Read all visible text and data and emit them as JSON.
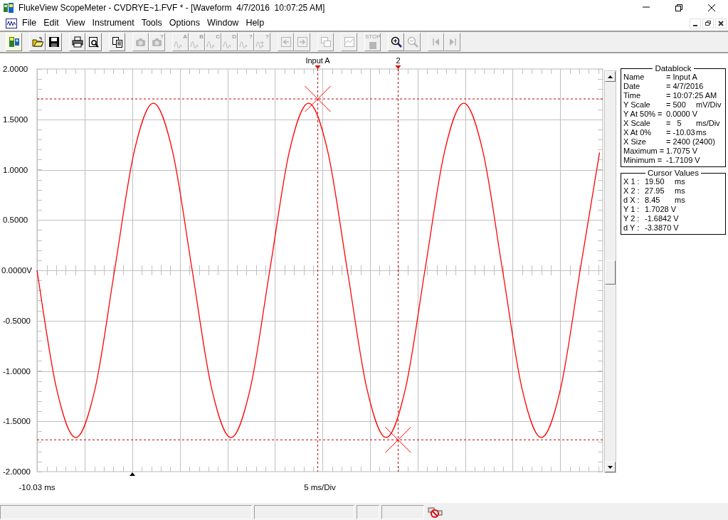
{
  "window": {
    "title": "FlukeView ScopeMeter - CVDRYE~1.FVF * - [Waveform  4/7/2016  10:07:25 AM]"
  },
  "menu": [
    "File",
    "Edit",
    "View",
    "Instrument",
    "Tools",
    "Options",
    "Window",
    "Help"
  ],
  "toolbar": [
    [
      {
        "kind": "connect",
        "disabled": false
      }
    ],
    [
      {
        "kind": "open",
        "disabled": false
      },
      {
        "kind": "save",
        "disabled": false
      }
    ],
    [
      {
        "kind": "print",
        "disabled": false
      },
      {
        "kind": "preview",
        "disabled": false
      }
    ],
    [
      {
        "kind": "copy",
        "disabled": false
      }
    ],
    [
      {
        "kind": "camera",
        "disabled": true
      },
      {
        "kind": "camera",
        "disabled": true,
        "caption": "?"
      }
    ],
    [
      {
        "kind": "wave",
        "disabled": true,
        "caption": "A"
      },
      {
        "kind": "wave",
        "disabled": true,
        "caption": "B"
      },
      {
        "kind": "wave",
        "disabled": true,
        "caption": "C"
      },
      {
        "kind": "wave",
        "disabled": true,
        "caption": "D"
      },
      {
        "kind": "wave",
        "disabled": true,
        "caption": "?"
      },
      {
        "kind": "wave-send",
        "disabled": true,
        "caption": "?"
      }
    ],
    [
      {
        "kind": "import",
        "disabled": true
      },
      {
        "kind": "export",
        "disabled": true
      }
    ],
    [
      {
        "kind": "windows",
        "disabled": true
      }
    ],
    [
      {
        "kind": "trend",
        "disabled": true
      }
    ],
    [
      {
        "kind": "stop",
        "disabled": true,
        "caption": "STOP"
      }
    ],
    [
      {
        "kind": "zoom-in",
        "disabled": false
      },
      {
        "kind": "zoom-out",
        "disabled": true
      }
    ],
    [
      {
        "kind": "first",
        "disabled": true
      },
      {
        "kind": "last",
        "disabled": true
      }
    ]
  ],
  "plot": {
    "chart_data": {
      "type": "line",
      "ylim": [
        -2,
        2
      ],
      "grid": true,
      "yticks": [
        {
          "value": 2,
          "label": "2.0000"
        },
        {
          "value": 1.5,
          "label": "1.5000"
        },
        {
          "value": 1,
          "label": "1.0000"
        },
        {
          "value": 0.5,
          "label": "0.5000"
        },
        {
          "value": 0,
          "label": "0.0000V"
        },
        {
          "value": -0.5,
          "label": "-0.5000"
        },
        {
          "value": -1,
          "label": "-1.0000"
        },
        {
          "value": -1.5,
          "label": "-1.5000"
        },
        {
          "value": -2,
          "label": "-2.0000"
        }
      ],
      "xlabel": "5 ms/Div",
      "series": [
        {
          "name": "Input A",
          "color": "#ff0000",
          "values": [
            0,
            -1.17,
            -1.66,
            -1.17,
            0,
            1.17,
            1.66,
            1.17,
            0,
            -1.17,
            -1.66,
            -1.17,
            0,
            1.17,
            1.66,
            1.17,
            0,
            -1.17,
            -1.66,
            -1.17,
            0,
            1.17,
            1.66,
            1.17,
            0,
            -1.17,
            -1.66,
            -1.17,
            0,
            1.17
          ]
        }
      ],
      "annotations": [
        {
          "text": "2"
        },
        {
          "text": "-10.03 ms"
        }
      ]
    }
  },
  "datablock": {
    "title": "Datablock",
    "rows": [
      {
        "label": "Name",
        "value": "= Input A"
      },
      {
        "label": "Date",
        "value": "= 4/7/2016"
      },
      {
        "label": "Time",
        "value": "= 10:07:25 AM"
      },
      {
        "label": "Y Scale",
        "value": "= 500",
        "unit": "mV/Div"
      },
      {
        "label": "Y At 50% =",
        "value": "0.0000 V"
      },
      {
        "label": "X Scale",
        "value": "=   5",
        "unit": "ms/Div"
      },
      {
        "label": "X At 0%",
        "value": "= -10.03",
        "unit": "ms"
      },
      {
        "label": "X Size",
        "value": "= 2400 (2400)"
      },
      {
        "label": "Maximum =",
        "value": "1.7075 V"
      },
      {
        "label": "Minimum =",
        "value": "-1.7109 V"
      }
    ]
  },
  "cursor_values": {
    "title": "Cursor Values",
    "rows": [
      {
        "label": "X 1 :",
        "value": "19.50",
        "unit": "ms"
      },
      {
        "label": "X 2 :",
        "value": "27.95",
        "unit": "ms"
      },
      {
        "label": "d X :",
        "value": "8.45",
        "unit": "ms"
      },
      {
        "label": "Y 1 :",
        "value": "1.7028 V"
      },
      {
        "label": "Y 2 :",
        "value": "-1.6842 V"
      },
      {
        "label": "d Y :",
        "value": "-3.3870 V"
      }
    ]
  }
}
